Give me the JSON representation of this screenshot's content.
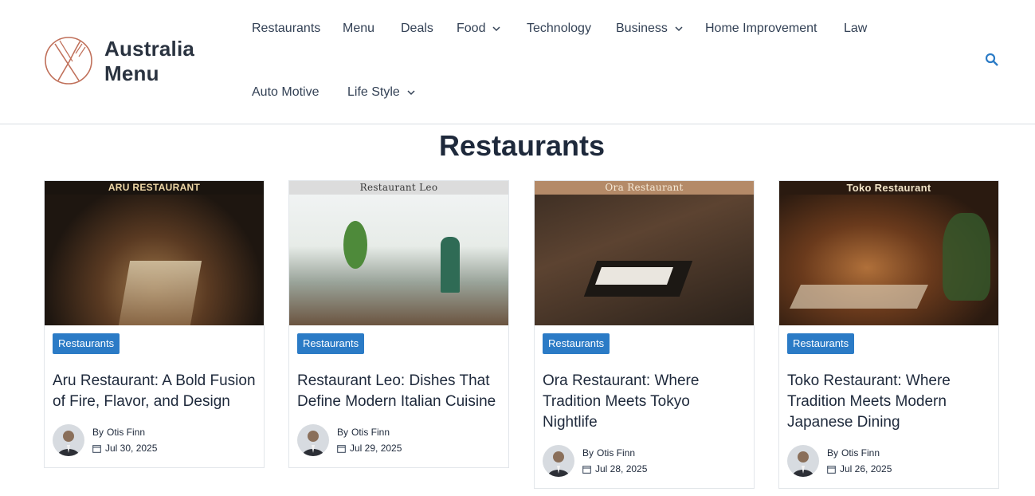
{
  "site": {
    "brand_line1": "Australia",
    "brand_line2": "Menu"
  },
  "nav": {
    "items": [
      {
        "label": "Restaurants"
      },
      {
        "label": "Menu"
      },
      {
        "label": "Deals"
      },
      {
        "label": "Food"
      },
      {
        "label": "Technology"
      },
      {
        "label": "Business"
      },
      {
        "label": "Home Improvement"
      },
      {
        "label": "Law"
      },
      {
        "label": "Auto Motive"
      },
      {
        "label": "Life Style"
      }
    ]
  },
  "page": {
    "title": "Restaurants"
  },
  "colors": {
    "accent": "#2b7bc6",
    "logo": "#c0705a",
    "text": "#1e293b"
  },
  "posts": [
    {
      "image_banner": "ARU RESTAURANT",
      "category": "Restaurants",
      "title": "Aru Restaurant: A Bold Fusion of Fire, Flavor, and Design",
      "by": "By",
      "author": "Otis Finn",
      "date": "Jul 30, 2025"
    },
    {
      "image_banner": "Restaurant Leo",
      "category": "Restaurants",
      "title": "Restaurant Leo: Dishes That Define Modern Italian Cuisine",
      "by": "By",
      "author": "Otis Finn",
      "date": "Jul 29, 2025"
    },
    {
      "image_banner": "Ora Restaurant",
      "category": "Restaurants",
      "title": "Ora Restaurant: Where Tradition Meets Tokyo Nightlife",
      "by": "By",
      "author": "Otis Finn",
      "date": "Jul 28, 2025"
    },
    {
      "image_banner": "Toko Restaurant",
      "category": "Restaurants",
      "title": "Toko Restaurant: Where Tradition Meets Modern Japanese Dining",
      "by": "By",
      "author": "Otis Finn",
      "date": "Jul 26, 2025"
    }
  ]
}
